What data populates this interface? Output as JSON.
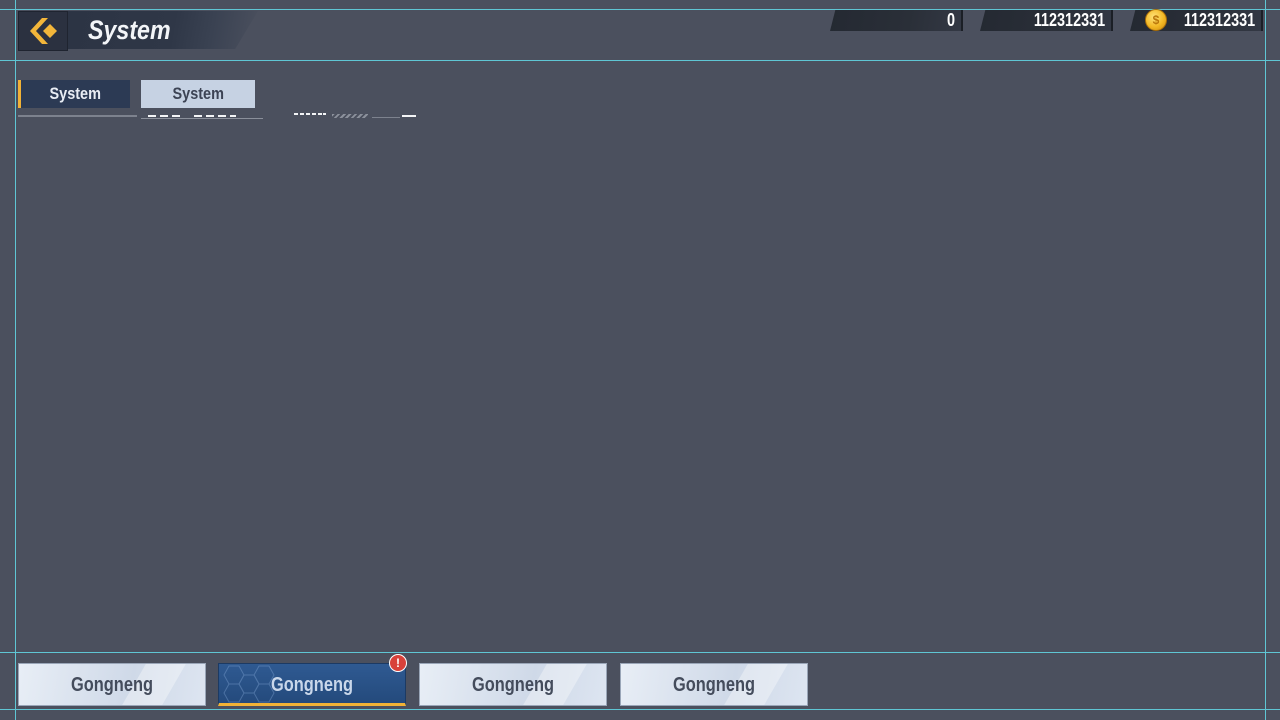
{
  "header": {
    "title": "System",
    "back_icon": "chevron-left-icon",
    "accent_color": "#f1b236"
  },
  "currencies": [
    {
      "value": "0"
    },
    {
      "value": "112312331"
    },
    {
      "value": "112312331",
      "icon": "gold-coin-icon"
    }
  ],
  "tabs": [
    {
      "label": "System",
      "active": true
    },
    {
      "label": "System",
      "active": false
    }
  ],
  "bottom_nav": [
    {
      "label": "Gongneng",
      "selected": false
    },
    {
      "label": "Gongneng",
      "selected": true,
      "alert": "!"
    },
    {
      "label": "Gongneng",
      "selected": false
    },
    {
      "label": "Gongneng",
      "selected": false
    }
  ]
}
